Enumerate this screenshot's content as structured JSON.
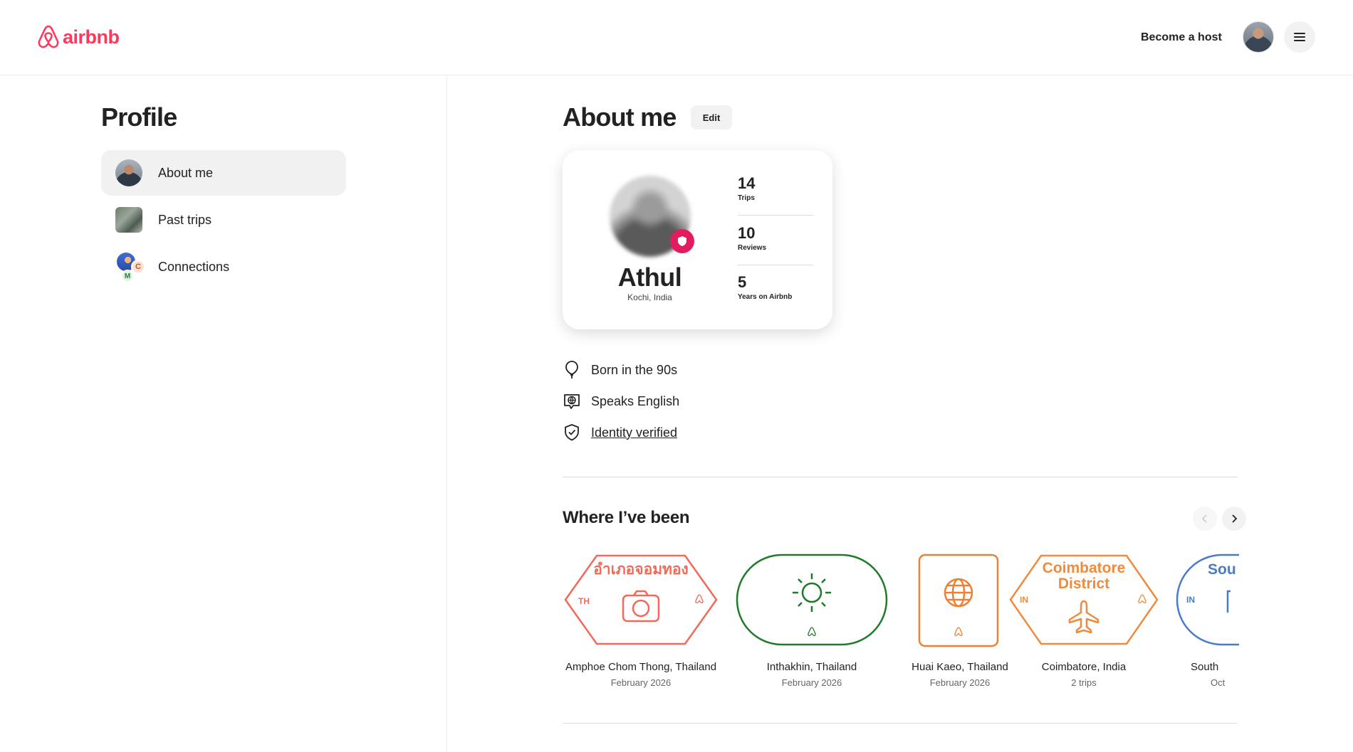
{
  "header": {
    "logo_text": "airbnb",
    "become_host_label": "Become a host"
  },
  "sidebar": {
    "title": "Profile",
    "items": [
      {
        "label": "About me"
      },
      {
        "label": "Past trips"
      },
      {
        "label": "Connections"
      }
    ],
    "connections_badges": [
      "C",
      "M"
    ]
  },
  "main": {
    "title": "About me",
    "edit_label": "Edit",
    "profile": {
      "name": "Athul",
      "location": "Kochi, India",
      "stats": [
        {
          "value": "14",
          "label": "Trips"
        },
        {
          "value": "10",
          "label": "Reviews"
        },
        {
          "value": "5",
          "label": "Years on Airbnb"
        }
      ]
    },
    "facts": [
      {
        "icon": "balloon-icon",
        "text": "Born in the 90s"
      },
      {
        "icon": "speech-globe-icon",
        "text": "Speaks English"
      },
      {
        "icon": "shield-check-icon",
        "text": "Identity verified"
      }
    ],
    "where": {
      "title": "Where I’ve been",
      "stamps": [
        {
          "stamp_text": "อำเภอจอมทอง",
          "country_code": "TH",
          "icon": "camera-icon",
          "color": "#f2695a",
          "title": "Amphoe Chom Thong, Thailand",
          "subtitle": "February 2026"
        },
        {
          "stamp_text": "",
          "country_code": "",
          "icon": "sun-icon",
          "color": "#1f7a2a",
          "title": "Inthakhin, Thailand",
          "subtitle": "February 2026"
        },
        {
          "stamp_text": "",
          "country_code": "",
          "icon": "globe-icon",
          "color": "#ee8033",
          "title": "Huai Kaeo, Thailand",
          "subtitle": "February 2026"
        },
        {
          "stamp_text_line1": "Coimbatore",
          "stamp_text_line2": "District",
          "country_code": "IN",
          "icon": "airplane-icon",
          "color": "#f08a3c",
          "title": "Coimbatore, India",
          "subtitle": "2 trips"
        },
        {
          "stamp_text": "Sou",
          "country_code": "IN",
          "icon": "",
          "color": "#4a7bc8",
          "title": "South",
          "subtitle": "Oct"
        }
      ]
    }
  },
  "colors": {
    "brand": "#ff385c",
    "verified_badge": "#e31c5f"
  }
}
